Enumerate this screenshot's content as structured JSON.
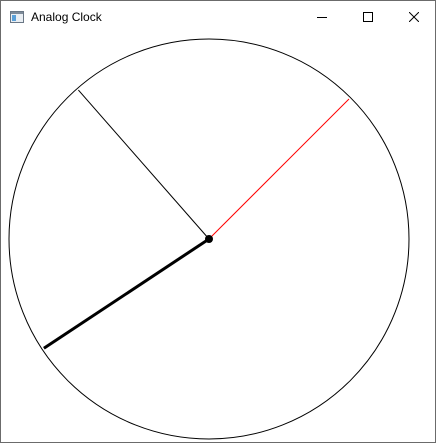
{
  "window": {
    "title": "Analog Clock",
    "app_icon": "window-app-icon",
    "controls": {
      "minimize_icon": "minimize-icon",
      "maximize_icon": "maximize-icon",
      "close_icon": "close-icon"
    }
  },
  "clock": {
    "time": {
      "hours": 7,
      "minutes": 53,
      "seconds": 7.5
    },
    "colors": {
      "face_stroke": "#000000",
      "hour_hand": "#000000",
      "minute_hand": "#000000",
      "second_hand": "#ff0000",
      "center_pin": "#000000"
    }
  }
}
